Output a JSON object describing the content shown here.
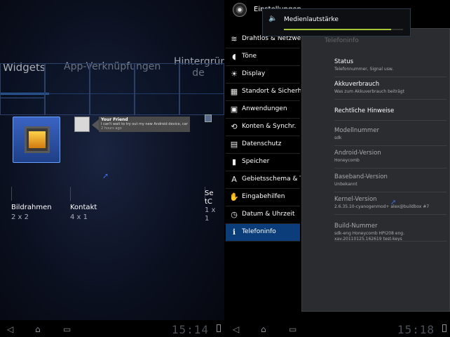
{
  "left": {
    "tabs": {
      "widgets": "Widgets",
      "apps": "App-Verknüpfungen",
      "background_line1": "Hintergrün",
      "background_line2": "de"
    },
    "contact_preview": {
      "name": "Your Friend",
      "text": "I can't wait to try out my new Android device, can't hav",
      "time": "2 hours ago"
    },
    "widgets": [
      {
        "name": "Bildrahmen",
        "size": "2 x 2"
      },
      {
        "name": "Kontakt",
        "size": "4 x 1"
      },
      {
        "name": "Se tC",
        "size": "1 x 1"
      }
    ],
    "clock": "15:14"
  },
  "right": {
    "header_title": "Einstellungen",
    "volume": {
      "label": "Medienlautstärke",
      "level": 0.9,
      "accent": "#a6c63a"
    },
    "sidebar_items": [
      {
        "label": "Drahtlos & Netzwerke",
        "icon": "wifi-icon"
      },
      {
        "label": "Töne",
        "icon": "speaker-icon"
      },
      {
        "label": "Display",
        "icon": "display-icon"
      },
      {
        "label": "Standort & Sicherheit",
        "icon": "grid-icon"
      },
      {
        "label": "Anwendungen",
        "icon": "apps-icon"
      },
      {
        "label": "Konten & Synchr.",
        "icon": "sync-icon"
      },
      {
        "label": "Datenschutz",
        "icon": "privacy-icon"
      },
      {
        "label": "Speicher",
        "icon": "storage-icon"
      },
      {
        "label": "Gebietsschema & Text",
        "icon": "locale-icon"
      },
      {
        "label": "Eingabehilfen",
        "icon": "accessibility-icon"
      },
      {
        "label": "Datum & Uhrzeit",
        "icon": "clock-icon"
      },
      {
        "label": "Telefoninfo",
        "icon": "info-icon"
      }
    ],
    "selected_index": 11,
    "content_title": "Telefoninfo",
    "info_rows": [
      {
        "title": "Status",
        "sub": "Telefonnummer, Signal usw."
      },
      {
        "title": "Akkuverbrauch",
        "sub": "Was zum Akkuverbrauch beiträgt"
      },
      {
        "title": "Rechtliche Hinweise",
        "sub": ""
      },
      {
        "title": "Modellnummer",
        "sub": "sdk"
      },
      {
        "title": "Android-Version",
        "sub": "Honeycomb"
      },
      {
        "title": "Baseband-Version",
        "sub": "Unbekannt"
      },
      {
        "title": "Kernel-Version",
        "sub": "2.6.35.10-cyanogenmod+ alex@buildbox #7"
      },
      {
        "title": "Build-Nummer",
        "sub": "sdk-eng Honeycomb HPI208 eng. xav.20110125.162619 test-keys"
      }
    ],
    "clock": "15:18"
  },
  "colors": {
    "accent_blue": "#3d8fe8",
    "selected_bg": "#0b3d7a"
  }
}
